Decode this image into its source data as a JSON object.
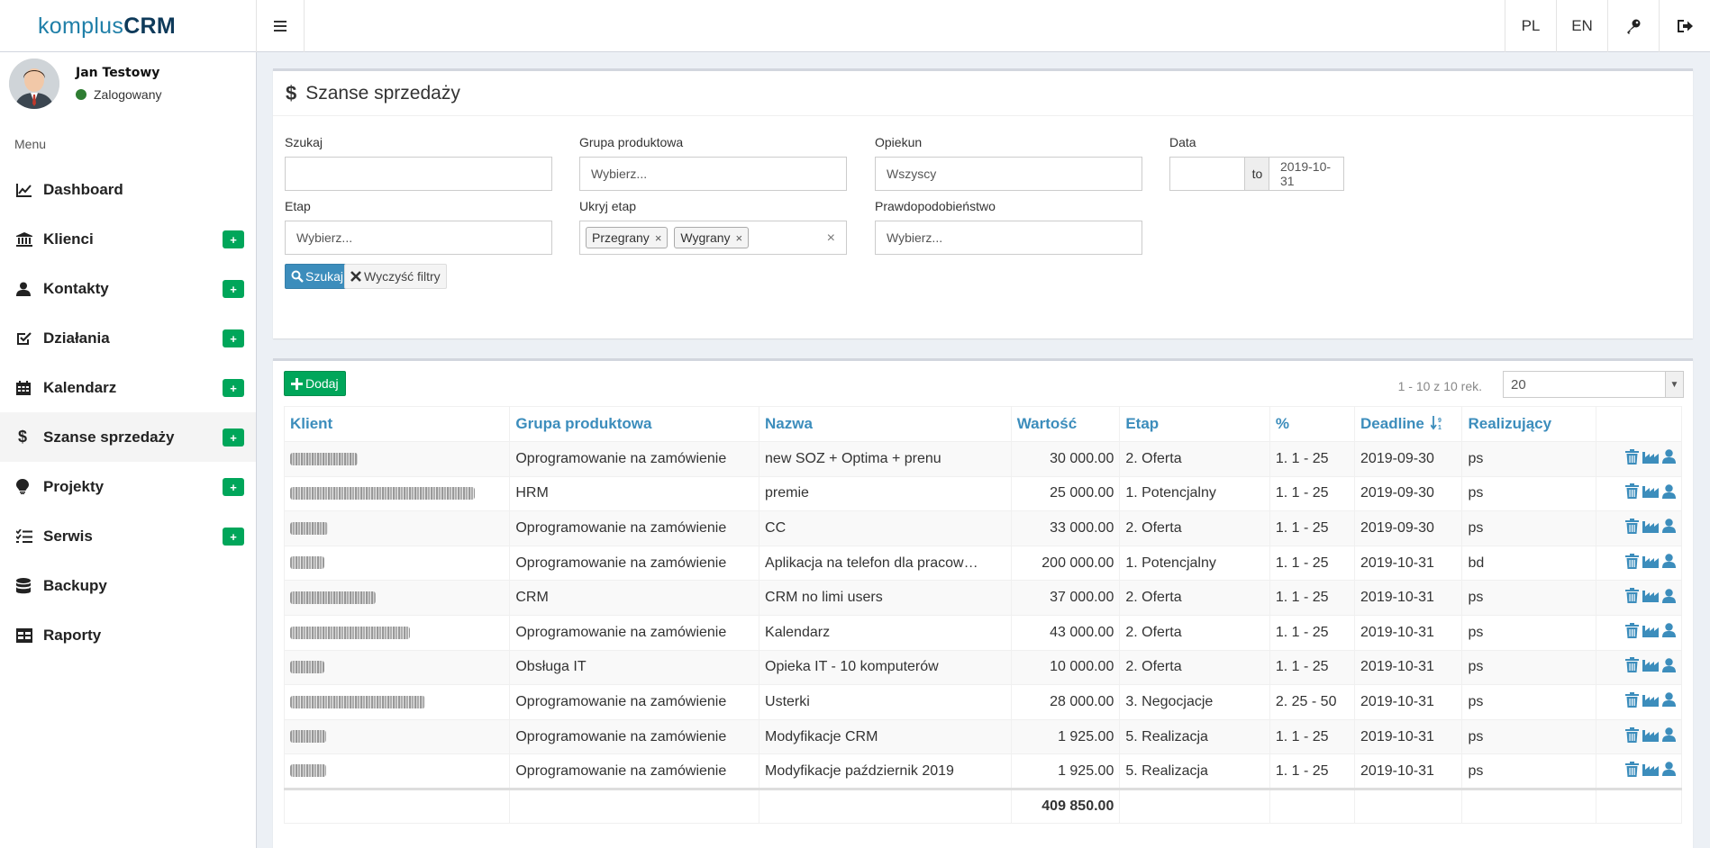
{
  "app": {
    "logo_light": "komplus",
    "logo_bold": "CRM"
  },
  "topbar": {
    "lang_pl": "PL",
    "lang_en": "EN",
    "key_icon": "key-icon",
    "logout_icon": "logout-icon"
  },
  "user": {
    "name": "Jan Testowy",
    "status": "Zalogowany",
    "status_color": "#2e7d32"
  },
  "sidebar": {
    "menu_header": "Menu",
    "add_badge": "+",
    "items": [
      {
        "label": "Dashboard",
        "icon": "chart-line-icon",
        "plus": false,
        "active": false
      },
      {
        "label": "Klienci",
        "icon": "bank-icon",
        "plus": true,
        "active": false
      },
      {
        "label": "Kontakty",
        "icon": "user-icon",
        "plus": true,
        "active": false
      },
      {
        "label": "Działania",
        "icon": "check-square-icon",
        "plus": true,
        "active": false
      },
      {
        "label": "Kalendarz",
        "icon": "calendar-icon",
        "plus": true,
        "active": false
      },
      {
        "label": "Szanse sprzedaży",
        "icon": "dollar-icon",
        "plus": true,
        "active": true
      },
      {
        "label": "Projekty",
        "icon": "lightbulb-icon",
        "plus": true,
        "active": false
      },
      {
        "label": "Serwis",
        "icon": "tasks-icon",
        "plus": true,
        "active": false
      },
      {
        "label": "Backupy",
        "icon": "database-icon",
        "plus": false,
        "active": false
      },
      {
        "label": "Raporty",
        "icon": "table-icon",
        "plus": false,
        "active": false
      }
    ]
  },
  "filters": {
    "title": "Szanse sprzedaży",
    "szukaj_label": "Szukaj",
    "szukaj_value": "",
    "grupa_label": "Grupa produktowa",
    "grupa_placeholder": "Wybierz...",
    "opiekun_label": "Opiekun",
    "opiekun_value": "Wszyscy",
    "data_label": "Data",
    "date_from": "",
    "date_to_sep": "to",
    "date_to": "2019-10-31",
    "etap_label": "Etap",
    "etap_placeholder": "Wybierz...",
    "ukryj_label": "Ukryj etap",
    "ukryj_tags": [
      "Przegrany",
      "Wygrany"
    ],
    "tag_remove": "×",
    "clear_all": "×",
    "prawd_label": "Prawdopodobieństwo",
    "prawd_placeholder": "Wybierz...",
    "search_button": "Szukaj",
    "clear_button": "Wyczyść filtry"
  },
  "list": {
    "add_button": "Dodaj",
    "pager_info": "1 - 10 z 10 rek.",
    "page_size": "20",
    "columns": [
      "Klient",
      "Grupa produktowa",
      "Nazwa",
      "Wartość",
      "Etap",
      "%",
      "Deadline",
      "Realizujący"
    ],
    "rows": [
      {
        "grupa": "Oprogramowanie na zamówienie",
        "nazwa": "new SOZ + Optima + prenu",
        "wartosc": "30 000.00",
        "etap": "2. Oferta",
        "proc": "1. 1 - 25",
        "deadline": "2019-09-30",
        "real": "ps"
      },
      {
        "grupa": "HRM",
        "nazwa": "premie",
        "wartosc": "25 000.00",
        "etap": "1. Potencjalny",
        "proc": "1. 1 - 25",
        "deadline": "2019-09-30",
        "real": "ps"
      },
      {
        "grupa": "Oprogramowanie na zamówienie",
        "nazwa": "CC",
        "wartosc": "33 000.00",
        "etap": "2. Oferta",
        "proc": "1. 1 - 25",
        "deadline": "2019-09-30",
        "real": "ps"
      },
      {
        "grupa": "Oprogramowanie na zamówienie",
        "nazwa": "Aplikacja na telefon dla pracow…",
        "wartosc": "200 000.00",
        "etap": "1. Potencjalny",
        "proc": "1. 1 - 25",
        "deadline": "2019-10-31",
        "real": "bd"
      },
      {
        "grupa": "CRM",
        "nazwa": "CRM no limi users",
        "wartosc": "37 000.00",
        "etap": "2. Oferta",
        "proc": "1. 1 - 25",
        "deadline": "2019-10-31",
        "real": "ps"
      },
      {
        "grupa": "Oprogramowanie na zamówienie",
        "nazwa": "Kalendarz",
        "wartosc": "43 000.00",
        "etap": "2. Oferta",
        "proc": "1. 1 - 25",
        "deadline": "2019-10-31",
        "real": "ps"
      },
      {
        "grupa": "Obsługa IT",
        "nazwa": "Opieka IT - 10 komputerów",
        "wartosc": "10 000.00",
        "etap": "2. Oferta",
        "proc": "1. 1 - 25",
        "deadline": "2019-10-31",
        "real": "ps"
      },
      {
        "grupa": "Oprogramowanie na zamówienie",
        "nazwa": "Usterki",
        "wartosc": "28 000.00",
        "etap": "3. Negocjacje",
        "proc": "2. 25 - 50",
        "deadline": "2019-10-31",
        "real": "ps"
      },
      {
        "grupa": "Oprogramowanie na zamówienie",
        "nazwa": "Modyfikacje CRM",
        "wartosc": "1 925.00",
        "etap": "5. Realizacja",
        "proc": "1. 1 - 25",
        "deadline": "2019-10-31",
        "real": "ps"
      },
      {
        "grupa": "Oprogramowanie na zamówienie",
        "nazwa": "Modyfikacje październik 2019",
        "wartosc": "1 925.00",
        "etap": "5. Realizacja",
        "proc": "1. 1 - 25",
        "deadline": "2019-10-31",
        "real": "ps"
      }
    ],
    "total": "409 850.00"
  },
  "colors": {
    "accent": "#3c8dbc",
    "success": "#00a65a",
    "action_icon": "#3c8dbc"
  }
}
